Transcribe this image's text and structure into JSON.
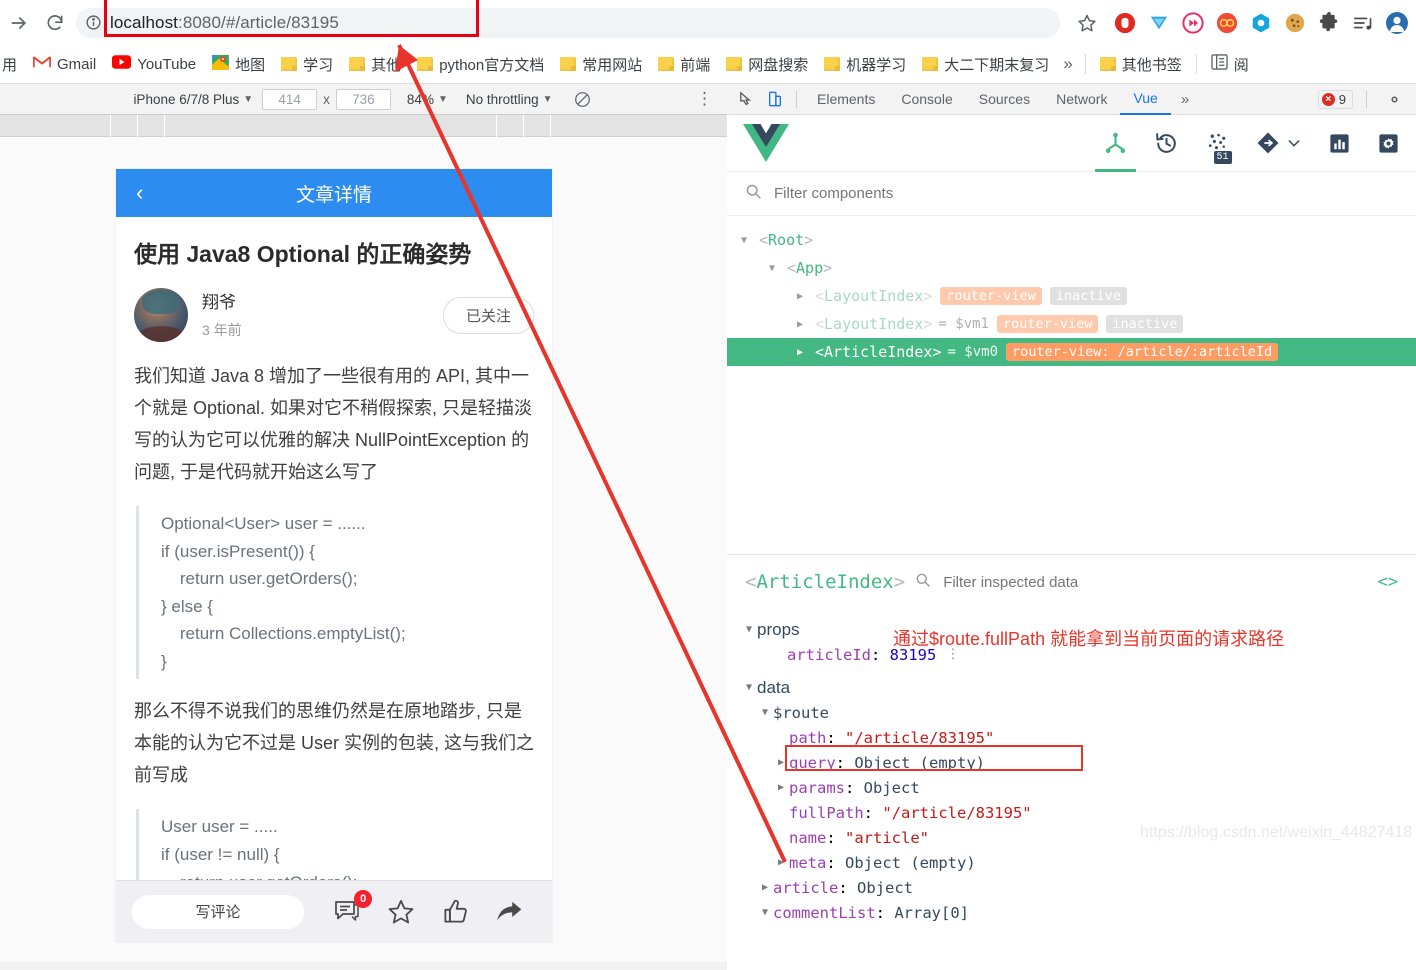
{
  "browser": {
    "url_bold": "localhost",
    "url_rest": ":8080/#/article/83195",
    "url_full": "localhost:8080/#/article/83195",
    "icons": {
      "back": "back-arrow-icon",
      "reload": "reload-icon",
      "info": "page-info-icon",
      "star": "bookmark-star-icon"
    },
    "extensions": [
      {
        "name": "adblock-icon"
      },
      {
        "name": "tampermonkey-icon"
      },
      {
        "name": "video-downloader-icon"
      },
      {
        "name": "infinity-icon"
      },
      {
        "name": "hexagon-icon"
      },
      {
        "name": "cookie-icon"
      },
      {
        "name": "puzzle-extensions-icon"
      },
      {
        "name": "music-playlist-icon"
      },
      {
        "name": "profile-avatar-icon"
      }
    ]
  },
  "bookmarks": {
    "items": [
      {
        "label": "用",
        "icon": "apps-icon"
      },
      {
        "label": "Gmail",
        "icon": "gmail-icon"
      },
      {
        "label": "YouTube",
        "icon": "youtube-icon"
      },
      {
        "label": "地图",
        "icon": "maps-icon"
      },
      {
        "label": "学习",
        "icon": "folder-icon"
      },
      {
        "label": "其他",
        "icon": "folder-icon"
      },
      {
        "label": "python官方文档",
        "icon": "folder-icon"
      },
      {
        "label": "常用网站",
        "icon": "folder-icon"
      },
      {
        "label": "前端",
        "icon": "folder-icon"
      },
      {
        "label": "网盘搜索",
        "icon": "folder-icon"
      },
      {
        "label": "机器学习",
        "icon": "folder-icon"
      },
      {
        "label": "大二下期末复习",
        "icon": "folder-icon"
      }
    ],
    "overflow": "»",
    "other_bookmarks": {
      "label": "其他书签",
      "icon": "folder-icon"
    },
    "reading_list": {
      "label": "阅",
      "icon": "reading-list-icon"
    }
  },
  "device_toolbar": {
    "device": "iPhone 6/7/8 Plus",
    "width": "414",
    "height": "736",
    "times": "x",
    "zoom": "84%",
    "throttling": "No throttling",
    "rotate_icon": "rotate-icon",
    "menu_icon": "more-vertical-icon"
  },
  "devtools": {
    "inspect_icon": "inspect-element-icon",
    "device_toggle_icon": "device-toolbar-icon",
    "tabs": [
      {
        "label": "Elements",
        "active": false
      },
      {
        "label": "Console",
        "active": false
      },
      {
        "label": "Sources",
        "active": false
      },
      {
        "label": "Network",
        "active": false
      },
      {
        "label": "Vue",
        "active": true
      }
    ],
    "more": "»",
    "error_count": "9",
    "settings_icon": "gear-icon"
  },
  "vue_devtools": {
    "logo": "vue-logo-icon",
    "tools": [
      {
        "name": "components-tree-icon",
        "active": true,
        "badge": ""
      },
      {
        "name": "timeline-history-icon",
        "active": false,
        "badge": ""
      },
      {
        "name": "vuex-state-icon",
        "active": false,
        "badge": "51"
      },
      {
        "name": "routes-icon",
        "active": false,
        "badge": ""
      },
      {
        "name": "performance-chart-icon",
        "active": false,
        "badge": ""
      },
      {
        "name": "settings-gear-icon",
        "active": false,
        "badge": ""
      }
    ],
    "chevron": "chevron-down-icon",
    "filter_placeholder": "Filter components",
    "tree": [
      {
        "indent": 0,
        "arrow": "▼",
        "name": "Root",
        "vm": "",
        "pills": [],
        "selected": false,
        "dim": false
      },
      {
        "indent": 1,
        "arrow": "▼",
        "name": "App",
        "vm": "",
        "pills": [],
        "selected": false,
        "dim": false
      },
      {
        "indent": 2,
        "arrow": "▶",
        "name": "LayoutIndex",
        "vm": "",
        "pills": [
          {
            "text": "router-view",
            "kind": "router"
          },
          {
            "text": "inactive",
            "kind": "inactive"
          }
        ],
        "selected": false,
        "dim": true
      },
      {
        "indent": 2,
        "arrow": "▶",
        "name": "LayoutIndex",
        "vm": "= $vm1",
        "pills": [
          {
            "text": "router-view",
            "kind": "router"
          },
          {
            "text": "inactive",
            "kind": "inactive"
          }
        ],
        "selected": false,
        "dim": true
      },
      {
        "indent": 2,
        "arrow": "▶",
        "name": "ArticleIndex",
        "vm": "= $vm0",
        "pills": [
          {
            "text": "router-view: /article/:articleId",
            "kind": "router"
          }
        ],
        "selected": true,
        "dim": false
      }
    ],
    "inspector": {
      "component_name": "ArticleIndex",
      "filter_placeholder": "Filter inspected data",
      "code_icon": "code-brackets-icon",
      "rows": [
        {
          "indent": 0,
          "arrow": "▼",
          "key": "props",
          "group": true,
          "value": "",
          "vtype": "",
          "dots": false,
          "boxed": false
        },
        {
          "indent": 1,
          "arrow": "",
          "key": "articleId",
          "group": false,
          "value": "83195",
          "vtype": "num",
          "dots": true,
          "boxed": false
        },
        {
          "indent": 0,
          "arrow": "▼",
          "key": "data",
          "group": true,
          "value": "",
          "vtype": "",
          "dots": false,
          "boxed": false
        },
        {
          "indent": 1,
          "arrow": "▼",
          "key": "$route",
          "group": false,
          "keyplain": true,
          "value": "",
          "vtype": "",
          "dots": false,
          "boxed": false
        },
        {
          "indent": 2,
          "arrow": "",
          "key": "path",
          "group": false,
          "value": "\"/article/83195\"",
          "vtype": "str",
          "dots": false,
          "boxed": false
        },
        {
          "indent": 2,
          "arrow": "▶",
          "key": "query",
          "group": false,
          "value": "Object (empty)",
          "vtype": "obj",
          "dots": false,
          "boxed": false
        },
        {
          "indent": 2,
          "arrow": "▶",
          "key": "params",
          "group": false,
          "value": "Object",
          "vtype": "obj",
          "dots": false,
          "boxed": false
        },
        {
          "indent": 2,
          "arrow": "",
          "key": "fullPath",
          "group": false,
          "value": "\"/article/83195\"",
          "vtype": "str",
          "dots": false,
          "boxed": true
        },
        {
          "indent": 2,
          "arrow": "",
          "key": "name",
          "group": false,
          "value": "\"article\"",
          "vtype": "str",
          "dots": false,
          "boxed": false
        },
        {
          "indent": 2,
          "arrow": "▶",
          "key": "meta",
          "group": false,
          "value": "Object (empty)",
          "vtype": "obj",
          "dots": false,
          "boxed": false
        },
        {
          "indent": 1,
          "arrow": "▶",
          "key": "article",
          "group": false,
          "value": "Object",
          "vtype": "obj",
          "dots": false,
          "boxed": false
        },
        {
          "indent": 1,
          "arrow": "▼",
          "key": "commentList",
          "group": false,
          "value": "Array[0]",
          "vtype": "obj",
          "dots": false,
          "boxed": false
        }
      ],
      "annotation": "通过$route.fullPath 就能拿到当前页面的请求路径"
    }
  },
  "page": {
    "header_title": "文章详情",
    "back_icon": "chevron-left-icon",
    "article_title": "使用 Java8 Optional 的正确姿势",
    "author": {
      "name": "翔爷",
      "time": "3 年前",
      "follow_label": "已关注",
      "avatar": "user-avatar"
    },
    "paragraph1": "我们知道 Java 8 增加了一些很有用的 API, 其中一个就是 Optional. 如果对它不稍假探索, 只是轻描淡写的认为它可以优雅的解决 NullPointException 的问题, 于是代码就开始这么写了",
    "code1": "Optional<User> user = ......\nif (user.isPresent()) {\n    return user.getOrders();\n} else {\n    return Collections.emptyList();\n}",
    "paragraph2": "那么不得不说我们的思维仍然是在原地踏步, 只是本能的认为它不过是 User 实例的包装, 这与我们之前写成",
    "code2": "User user = .....\nif (user != null) {\n    return user.getOrders();",
    "footer": {
      "comment_placeholder": "写评论",
      "comment_icon": "comment-icon",
      "comment_count": "0",
      "star_icon": "star-outline-icon",
      "like_icon": "thumbs-up-icon",
      "share_icon": "share-arrow-icon"
    }
  },
  "watermark": "https://blog.csdn.net/weixin_44827418",
  "colors": {
    "accent_blue": "#2d8cf0",
    "vue_green": "#42b883",
    "vue_dark": "#35495e",
    "annotation_red": "#e8342a",
    "devtools_blue": "#1a73e8"
  }
}
